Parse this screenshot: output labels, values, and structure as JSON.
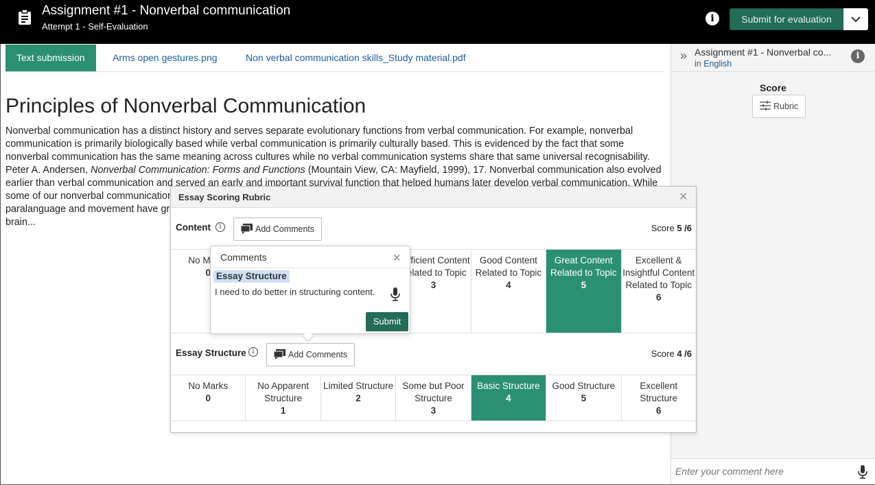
{
  "header": {
    "title": "Assignment #1 - Nonverbal communication",
    "subtitle": "Attempt 1 - Self-Evaluation",
    "submit_label": "Submit for evaluation"
  },
  "tabs": [
    {
      "label": "Text submission",
      "active": true
    },
    {
      "label": "Arms open gestures.png",
      "active": false
    },
    {
      "label": "Non verbal communication skills_Study material.pdf",
      "active": false
    }
  ],
  "document": {
    "title": "Principles of Nonverbal Communication",
    "p1": "Nonverbal communication has a distinct history and serves separate evolutionary functions from verbal communication. For example, nonverbal communication is primarily biologically based while verbal communication is primarily culturally based. This is evidenced by the fact that some nonverbal communication has the same meaning across cultures while no verbal communication systems share that same universal recognisability. Peter A. Andersen, ",
    "citation_italic": "Nonverbal Communication: Forms and Functions",
    "p2": " (Mountain View, CA: Mayfield, 1999), 17. Nonverbal communication also evolved earlier than verbal communication and served an early and important survival function that helped humans later develop verbal communication. While some of our nonverbal communication abilities, like our sense of smell, lost strength as our verbal capacities increased, other abilities like paralanguage and movement have grown alongside verbal complexity. The fact that nonverbal communication is processed by an older part of our brain..."
  },
  "right_panel": {
    "title": "Assignment #1 - Nonverbal co...",
    "in_label": "in",
    "language": "English",
    "score_label": "Score",
    "rubric_button": "Rubric",
    "comment_placeholder": "Enter your comment here"
  },
  "rubric": {
    "title": "Essay Scoring Rubric",
    "criteria": [
      {
        "name": "Content",
        "add_comments": "Add Comments",
        "score_prefix": "Score",
        "score": "5 /6",
        "levels": [
          {
            "label": "No Marks",
            "points": "0"
          },
          {
            "label": "",
            "points": ""
          },
          {
            "label": "",
            "points": ""
          },
          {
            "label": "Sufficient Content Related to Topic",
            "points": "3"
          },
          {
            "label": "Good Content Related to Topic",
            "points": "4"
          },
          {
            "label": "Great Content Related to Topic",
            "points": "5",
            "selected": true
          },
          {
            "label": "Excellent & Insightful Content Related to Topic",
            "points": "6"
          }
        ]
      },
      {
        "name": "Essay Structure",
        "add_comments": "Add Comments",
        "score_prefix": "Score",
        "score": "4 /6",
        "levels": [
          {
            "label": "No Marks",
            "points": "0"
          },
          {
            "label": "No Apparent Structure",
            "points": "1"
          },
          {
            "label": "Limited Structure",
            "points": "2"
          },
          {
            "label": "Some but Poor Structure",
            "points": "3"
          },
          {
            "label": "Basic Structure",
            "points": "4",
            "selected": true
          },
          {
            "label": "Good Structure",
            "points": "5"
          },
          {
            "label": "Excellent Structure",
            "points": "6"
          }
        ]
      }
    ]
  },
  "comments_popup": {
    "title": "Comments",
    "tag": "Essay Structure",
    "text": "I need to do better in structuring content.",
    "submit_label": "Submit"
  },
  "colors": {
    "accent": "#2b8f72",
    "submit": "#226c58",
    "link": "#1a5fa0"
  }
}
